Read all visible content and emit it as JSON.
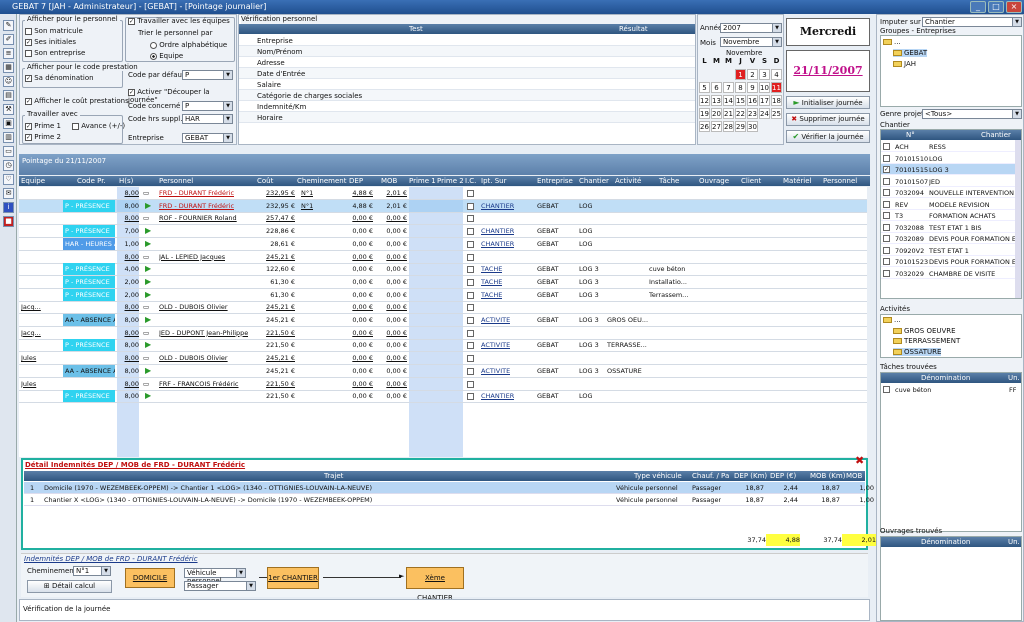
{
  "window": {
    "title": "GEBAT 7 [JAH - Administrateur] - [GEBAT] - [Pointage journalier]"
  },
  "personnel_options": {
    "title": "Afficher pour le personnel",
    "items": [
      {
        "label": "Son matricule",
        "checked": false
      },
      {
        "label": "Ses initiales",
        "checked": true
      },
      {
        "label": "Son entreprise",
        "checked": false
      }
    ]
  },
  "teams": {
    "label": "Travailler avec les équipes",
    "sort_label": "Trier le personnel par",
    "opt1": "Ordre alphabétique",
    "opt2": "Equipe"
  },
  "prestation": {
    "title": "Afficher pour le code prestation",
    "denomination": "Sa dénomination",
    "show_cost": "Afficher le coût prestations"
  },
  "work_with": {
    "title": "Travailler avec",
    "prime1": "Prime 1",
    "prime2": "Prime 2",
    "avance": "Avance (+/-)"
  },
  "codes": {
    "default_label": "Code par défaut",
    "default_value": "P",
    "split_label": "Activer \"Découper la journée\"",
    "concerned_label": "Code concerné",
    "concerned_value": "P",
    "hrs_label": "Code hrs suppl.",
    "hrs_value": "HAR",
    "company_label": "Entreprise",
    "company_value": "GEBAT"
  },
  "verif": {
    "title": "Vérification personnel",
    "col_test": "Test",
    "col_result": "Résultat",
    "items": [
      "Entreprise",
      "Nom/Prénom",
      "Adresse",
      "Date d'Entrée",
      "Salaire",
      "Catégorie de charges sociales",
      "Indemnité/Km",
      "Horaire"
    ]
  },
  "calendar": {
    "year_label": "Année",
    "year": "2007",
    "month_label": "Mois",
    "month": "Novembre",
    "month_title": "Novembre",
    "days": [
      "L",
      "M",
      "M",
      "J",
      "V",
      "S",
      "D"
    ],
    "weeks": [
      [
        "",
        "",
        "",
        "1",
        "2",
        "3",
        "4"
      ],
      [
        "5",
        "6",
        "7",
        "8",
        "9",
        "10",
        "11"
      ],
      [
        "12",
        "13",
        "14",
        "15",
        "16",
        "17",
        "18"
      ],
      [
        "19",
        "20",
        "21",
        "22",
        "23",
        "24",
        "25"
      ],
      [
        "26",
        "27",
        "28",
        "29",
        "30",
        "",
        ""
      ]
    ]
  },
  "date_box": {
    "weekday": "Mercredi",
    "date": "21/11/2007"
  },
  "actions": {
    "init": "Initialiser journée",
    "delete": "Supprimer journée",
    "verify": "Vérifier la journée"
  },
  "right": {
    "impute_label": "Imputer sur",
    "impute_value": "Chantier",
    "groups_label": "Groupes - Entreprises",
    "tree": [
      "...",
      "GEBAT",
      "JAH"
    ],
    "genre_label": "Genre projet",
    "genre_value": "<Tous>",
    "chantier_label": "Chantier",
    "col_no": "N°",
    "col_chantier": "Chantier",
    "chantiers": [
      [
        "ACH",
        "RESS"
      ],
      [
        "70101510",
        "LOG"
      ],
      [
        "70101515",
        "LOG 3"
      ],
      [
        "70101507",
        "JED"
      ],
      [
        "7032094",
        "NOUVELLE INTERVENTION 1"
      ],
      [
        "REV",
        "MODELE REVISION"
      ],
      [
        "T3",
        "FORMATION ACHATS"
      ],
      [
        "7032088",
        "TEST ETAT 1 BIS"
      ],
      [
        "7032089",
        "DEVIS POUR FORMATION ETA"
      ],
      [
        "70920V2",
        "TEST ETAT 1"
      ],
      [
        "70101523",
        "DEVIS POUR FORMATION ETA"
      ],
      [
        "7032029",
        "CHAMBRE DE VISITE"
      ]
    ],
    "activities_label": "Activités",
    "activities": [
      "...",
      "GROS OEUVRE",
      "TERRASSEMENT",
      "OSSATURE"
    ],
    "tasks_label": "Tâches trouvées",
    "tasks_col1": "Dénomination",
    "tasks_col2": "Un.",
    "tasks": [
      [
        "cuve béton",
        "FF"
      ]
    ],
    "works_label": "Ouvrages trouvés",
    "works_col1": "Dénomination",
    "works_col2": "Un."
  },
  "pointage": {
    "title": "Pointage du 21/11/2007",
    "cols": [
      "Equipe",
      "Code Pr.",
      "H(s)",
      "Personnel",
      "Coût",
      "Cheminement",
      "DEP",
      "MOB",
      "Prime 1",
      "Prime 2",
      "I.C.",
      "Ipt. Sur",
      "Entreprise",
      "Chantier",
      "Activité",
      "Tâche",
      "Ouvrage",
      "Client",
      "Matériel",
      "Personnel"
    ],
    "rows": [
      {
        "eq": "",
        "code": "",
        "h": "8,00",
        "pers": "FRD - DURANT Frédéric",
        "cout": "232,95 €",
        "chem": "N°1",
        "dep": "4,88 €",
        "mob": "2,01 €",
        "ipt": "",
        "ent": "",
        "ch": "",
        "act": "",
        "tache": "",
        "type": "sum-red"
      },
      {
        "eq": "",
        "code": "P - PRÉSENCE",
        "h": "8,00",
        "pers": "FRD - DURANT Frédéric",
        "cout": "232,95 €",
        "chem": "N°1",
        "dep": "4,88 €",
        "mob": "2,01 €",
        "ipt": "CHANTIER",
        "ent": "GEBAT",
        "ch": "LOG",
        "act": "",
        "tache": "",
        "type": "sel"
      },
      {
        "eq": "",
        "code": "",
        "h": "8,00",
        "pers": "ROF - FOURNIER Roland",
        "cout": "257,47 €",
        "chem": "",
        "dep": "0,00 €",
        "mob": "0,00 €",
        "ipt": "",
        "ent": "",
        "ch": "",
        "act": "",
        "tache": "",
        "type": "sum"
      },
      {
        "eq": "",
        "code": "P - PRÉSENCE",
        "h": "7,00",
        "pers": "",
        "cout": "228,86 €",
        "chem": "",
        "dep": "0,00 €",
        "mob": "0,00 €",
        "ipt": "CHANTIER",
        "ent": "GEBAT",
        "ch": "LOG",
        "act": "",
        "tache": "",
        "type": "pres"
      },
      {
        "eq": "",
        "code": "HAR - HEURES A",
        "h": "1,00",
        "pers": "",
        "cout": "28,61 €",
        "chem": "",
        "dep": "0,00 €",
        "mob": "0,00 €",
        "ipt": "CHANTIER",
        "ent": "GEBAT",
        "ch": "LOG",
        "act": "",
        "tache": "",
        "type": "hour"
      },
      {
        "eq": "",
        "code": "",
        "h": "8,00",
        "pers": "JAL - LEPIED Jacques",
        "cout": "245,21 €",
        "chem": "",
        "dep": "0,00 €",
        "mob": "0,00 €",
        "ipt": "",
        "ent": "",
        "ch": "",
        "act": "",
        "tache": "",
        "type": "sum"
      },
      {
        "eq": "",
        "code": "P - PRÉSENCE",
        "h": "4,00",
        "pers": "",
        "cout": "122,60 €",
        "chem": "",
        "dep": "0,00 €",
        "mob": "0,00 €",
        "ipt": "TACHE",
        "ent": "GEBAT",
        "ch": "LOG 3",
        "act": "",
        "tache": "cuve béton",
        "type": "pres"
      },
      {
        "eq": "",
        "code": "P - PRÉSENCE",
        "h": "2,00",
        "pers": "",
        "cout": "61,30 €",
        "chem": "",
        "dep": "0,00 €",
        "mob": "0,00 €",
        "ipt": "TACHE",
        "ent": "GEBAT",
        "ch": "LOG 3",
        "act": "",
        "tache": "Installatio...",
        "type": "pres"
      },
      {
        "eq": "",
        "code": "P - PRÉSENCE",
        "h": "2,00",
        "pers": "",
        "cout": "61,30 €",
        "chem": "",
        "dep": "0,00 €",
        "mob": "0,00 €",
        "ipt": "TACHE",
        "ent": "GEBAT",
        "ch": "LOG 3",
        "act": "",
        "tache": "Terrassem...",
        "type": "pres"
      },
      {
        "eq": "Jacq...",
        "code": "",
        "h": "8,00",
        "pers": "OLD - DUBOIS Olivier",
        "cout": "245,21 €",
        "chem": "",
        "dep": "0,00 €",
        "mob": "0,00 €",
        "ipt": "",
        "ent": "",
        "ch": "",
        "act": "",
        "tache": "",
        "type": "sum"
      },
      {
        "eq": "",
        "code": "AA - ABSENCE AL",
        "h": "8,00",
        "pers": "",
        "cout": "245,21 €",
        "chem": "",
        "dep": "0,00 €",
        "mob": "0,00 €",
        "ipt": "ACTIVITE",
        "ent": "GEBAT",
        "ch": "LOG 3",
        "act": "GROS OEU...",
        "tache": "",
        "type": "abs"
      },
      {
        "eq": "Jacq...",
        "code": "",
        "h": "8,00",
        "pers": "JED - DUPONT Jean-Philippe",
        "cout": "221,50 €",
        "chem": "",
        "dep": "0,00 €",
        "mob": "0,00 €",
        "ipt": "",
        "ent": "",
        "ch": "",
        "act": "",
        "tache": "",
        "type": "sum"
      },
      {
        "eq": "",
        "code": "P - PRÉSENCE",
        "h": "8,00",
        "pers": "",
        "cout": "221,50 €",
        "chem": "",
        "dep": "0,00 €",
        "mob": "0,00 €",
        "ipt": "ACTIVITE",
        "ent": "GEBAT",
        "ch": "LOG 3",
        "act": "TERRASSE...",
        "tache": "",
        "type": "pres"
      },
      {
        "eq": "Jules",
        "code": "",
        "h": "8,00",
        "pers": "OLD - DUBOIS Olivier",
        "cout": "245,21 €",
        "chem": "",
        "dep": "0,00 €",
        "mob": "0,00 €",
        "ipt": "",
        "ent": "",
        "ch": "",
        "act": "",
        "tache": "",
        "type": "sum"
      },
      {
        "eq": "",
        "code": "AA - ABSENCE AL",
        "h": "8,00",
        "pers": "",
        "cout": "245,21 €",
        "chem": "",
        "dep": "0,00 €",
        "mob": "0,00 €",
        "ipt": "ACTIVITE",
        "ent": "GEBAT",
        "ch": "LOG 3",
        "act": "OSSATURE",
        "tache": "",
        "type": "abs"
      },
      {
        "eq": "Jules",
        "code": "",
        "h": "8,00",
        "pers": "FRF - FRANCOIS Frédéric",
        "cout": "221,50 €",
        "chem": "",
        "dep": "0,00 €",
        "mob": "0,00 €",
        "ipt": "",
        "ent": "",
        "ch": "",
        "act": "",
        "tache": "",
        "type": "sum"
      },
      {
        "eq": "",
        "code": "P - PRÉSENCE",
        "h": "8,00",
        "pers": "",
        "cout": "221,50 €",
        "chem": "",
        "dep": "0,00 €",
        "mob": "0,00 €",
        "ipt": "CHANTIER",
        "ent": "GEBAT",
        "ch": "LOG",
        "act": "",
        "tache": "",
        "type": "pres"
      }
    ]
  },
  "detail": {
    "title": "Détail Indemnités DEP / MOB de FRD - DURANT Frédéric",
    "cols": [
      "Trajet",
      "Type véhicule",
      "Chauf. / Pa",
      "DEP (Km)",
      "DEP (€)",
      "MOB (Km)",
      "MOB (€)"
    ],
    "rows": [
      [
        "1",
        "Domicile (1970 - WEZEMBEEK-OPPEM) -> Chantier 1 <LOG> (1340 - OTTIGNIES-LOUVAIN-LA-NEUVE)",
        "Véhicule personnel",
        "Passager",
        "18,87",
        "2,44",
        "18,87",
        "1,00"
      ],
      [
        "1",
        "Chantier X <LOG> (1340 - OTTIGNIES-LOUVAIN-LA-NEUVE) -> Domicile (1970 - WEZEMBEEK-OPPEM)",
        "Véhicule personnel",
        "Passager",
        "18,87",
        "2,44",
        "18,87",
        "1,00"
      ]
    ],
    "totals": [
      "37,74",
      "4,88",
      "37,74",
      "2,01"
    ]
  },
  "indemn": {
    "title": "Indemnités DEP / MOB de FRD - DURANT Frédéric",
    "chem_label": "Cheminement",
    "chem_value": "N°1",
    "detail_btn": "Détail calcul",
    "domicile": "DOMICILE",
    "vehicle": "Véhicule personnel",
    "passenger": "Passager",
    "first": "1er CHANTIER",
    "last": "Xème CHANTIER"
  },
  "footer": {
    "label": "Vérification de la journée"
  }
}
